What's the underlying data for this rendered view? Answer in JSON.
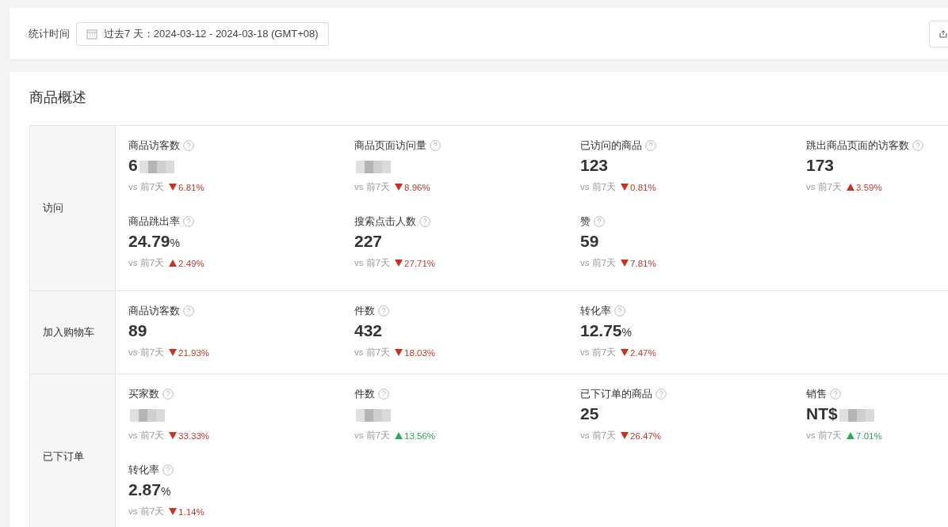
{
  "filter": {
    "label": "统计时间",
    "date_range": "过去7 天：2024-03-12 - 2024-03-18 (GMT+08)"
  },
  "overview": {
    "title": "商品概述",
    "groups": [
      {
        "label": "访问",
        "metrics": [
          {
            "name": "商品访客数",
            "value": "6",
            "redacted": true,
            "compare": "vs 前7天",
            "change": "6.81%",
            "kind": "down",
            "good": false
          },
          {
            "name": "商品页面访问量",
            "redacted": true,
            "compare": "vs 前7天",
            "change": "8.96%",
            "kind": "down",
            "good": false
          },
          {
            "name": "已访问的商品",
            "value": "123",
            "compare": "vs 前7天",
            "change": "0.81%",
            "kind": "down",
            "good": false
          },
          {
            "name": "跳出商品页面的访客数",
            "value": "173",
            "compare": "vs 前7天",
            "change": "3.59%",
            "kind": "up",
            "good": false
          },
          {
            "name": "商品跳出率",
            "value": "24.79",
            "unit": "%",
            "compare": "vs 前7天",
            "change": "2.49%",
            "kind": "up",
            "good": false
          },
          {
            "name": "搜索点击人数",
            "value": "227",
            "compare": "vs 前7天",
            "change": "27.71%",
            "kind": "down",
            "good": false
          },
          {
            "name": "赞",
            "value": "59",
            "compare": "vs 前7天",
            "change": "7.81%",
            "kind": "down",
            "good": false
          }
        ]
      },
      {
        "label": "加入购物车",
        "metrics": [
          {
            "name": "商品访客数",
            "value": "89",
            "compare": "vs 前7天",
            "change": "21.93%",
            "kind": "down",
            "good": false
          },
          {
            "name": "件数",
            "value": "432",
            "compare": "vs 前7天",
            "change": "18.03%",
            "kind": "down",
            "good": false
          },
          {
            "name": "转化率",
            "value": "12.75",
            "unit": "%",
            "compare": "vs 前7天",
            "change": "2.47%",
            "kind": "down",
            "good": false
          }
        ]
      },
      {
        "label": "已下订单",
        "metrics": [
          {
            "name": "买家数",
            "redacted": true,
            "compare": "vs 前7天",
            "change": "33.33%",
            "kind": "down",
            "good": false
          },
          {
            "name": "件数",
            "redacted": true,
            "compare": "vs 前7天",
            "change": "13.56%",
            "kind": "up",
            "good": true
          },
          {
            "name": "已下订单的商品",
            "value": "25",
            "compare": "vs 前7天",
            "change": "26.47%",
            "kind": "down",
            "good": false
          },
          {
            "name": "销售",
            "value": "NT$",
            "redacted": true,
            "compare": "vs 前7天",
            "change": "7.01%",
            "kind": "up",
            "good": true
          },
          {
            "name": "转化率",
            "value": "2.87",
            "unit": "%",
            "compare": "vs 前7天",
            "change": "1.14%",
            "kind": "down",
            "good": false
          }
        ]
      }
    ]
  }
}
